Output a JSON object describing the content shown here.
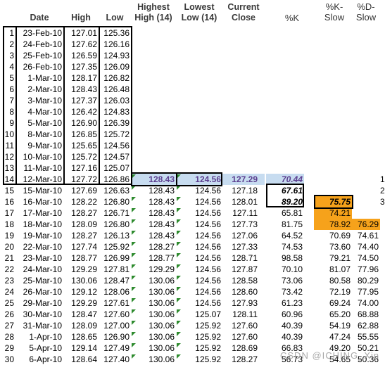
{
  "headers": {
    "date": "Date",
    "high": "High",
    "low": "Low",
    "highest_high": [
      "Highest",
      "High (14)"
    ],
    "lowest_low": [
      "Lowest",
      "Low (14)"
    ],
    "current_close": [
      "Current",
      "Close"
    ],
    "pct_k": "%K",
    "pct_k_slow": [
      "%K-",
      "Slow"
    ],
    "pct_d_slow": [
      "%D-",
      "Slow"
    ]
  },
  "rows": [
    {
      "n": "1",
      "date": "23-Feb-10",
      "high": "127.01",
      "low": "125.36",
      "hh": "",
      "ll": "",
      "cc": "",
      "k": "",
      "ks": "",
      "ds": "",
      "ex": ""
    },
    {
      "n": "2",
      "date": "24-Feb-10",
      "high": "127.62",
      "low": "126.16",
      "hh": "",
      "ll": "",
      "cc": "",
      "k": "",
      "ks": "",
      "ds": "",
      "ex": ""
    },
    {
      "n": "3",
      "date": "25-Feb-10",
      "high": "126.59",
      "low": "124.93",
      "hh": "",
      "ll": "",
      "cc": "",
      "k": "",
      "ks": "",
      "ds": "",
      "ex": ""
    },
    {
      "n": "4",
      "date": "26-Feb-10",
      "high": "127.35",
      "low": "126.09",
      "hh": "",
      "ll": "",
      "cc": "",
      "k": "",
      "ks": "",
      "ds": "",
      "ex": ""
    },
    {
      "n": "5",
      "date": "1-Mar-10",
      "high": "128.17",
      "low": "126.82",
      "hh": "",
      "ll": "",
      "cc": "",
      "k": "",
      "ks": "",
      "ds": "",
      "ex": ""
    },
    {
      "n": "6",
      "date": "2-Mar-10",
      "high": "128.43",
      "low": "126.48",
      "hh": "",
      "ll": "",
      "cc": "",
      "k": "",
      "ks": "",
      "ds": "",
      "ex": ""
    },
    {
      "n": "7",
      "date": "3-Mar-10",
      "high": "127.37",
      "low": "126.03",
      "hh": "",
      "ll": "",
      "cc": "",
      "k": "",
      "ks": "",
      "ds": "",
      "ex": ""
    },
    {
      "n": "8",
      "date": "4-Mar-10",
      "high": "126.42",
      "low": "124.83",
      "hh": "",
      "ll": "",
      "cc": "",
      "k": "",
      "ks": "",
      "ds": "",
      "ex": ""
    },
    {
      "n": "9",
      "date": "5-Mar-10",
      "high": "126.90",
      "low": "126.39",
      "hh": "",
      "ll": "",
      "cc": "",
      "k": "",
      "ks": "",
      "ds": "",
      "ex": ""
    },
    {
      "n": "10",
      "date": "8-Mar-10",
      "high": "126.85",
      "low": "125.72",
      "hh": "",
      "ll": "",
      "cc": "",
      "k": "",
      "ks": "",
      "ds": "",
      "ex": ""
    },
    {
      "n": "11",
      "date": "9-Mar-10",
      "high": "125.65",
      "low": "124.56",
      "hh": "",
      "ll": "",
      "cc": "",
      "k": "",
      "ks": "",
      "ds": "",
      "ex": ""
    },
    {
      "n": "12",
      "date": "10-Mar-10",
      "high": "125.72",
      "low": "124.57",
      "hh": "",
      "ll": "",
      "cc": "",
      "k": "",
      "ks": "",
      "ds": "",
      "ex": ""
    },
    {
      "n": "13",
      "date": "11-Mar-10",
      "high": "127.16",
      "low": "125.07",
      "hh": "",
      "ll": "",
      "cc": "",
      "k": "",
      "ks": "",
      "ds": "",
      "ex": ""
    },
    {
      "n": "14",
      "date": "12-Mar-10",
      "high": "127.72",
      "low": "126.86",
      "hh": "128.43",
      "ll": "124.56",
      "cc": "127.29",
      "k": "70.44",
      "ks": "",
      "ds": "",
      "ex": "1"
    },
    {
      "n": "15",
      "date": "15-Mar-10",
      "high": "127.69",
      "low": "126.63",
      "hh": "128.43",
      "ll": "124.56",
      "cc": "127.18",
      "k": "67.61",
      "ks": "",
      "ds": "",
      "ex": "2"
    },
    {
      "n": "16",
      "date": "16-Mar-10",
      "high": "128.22",
      "low": "126.80",
      "hh": "128.43",
      "ll": "124.56",
      "cc": "128.01",
      "k": "89.20",
      "ks": "75.75",
      "ds": "",
      "ex": "3"
    },
    {
      "n": "17",
      "date": "17-Mar-10",
      "high": "128.27",
      "low": "126.71",
      "hh": "128.43",
      "ll": "124.56",
      "cc": "127.11",
      "k": "65.81",
      "ks": "74.21",
      "ds": "",
      "ex": ""
    },
    {
      "n": "18",
      "date": "18-Mar-10",
      "high": "128.09",
      "low": "126.80",
      "hh": "128.43",
      "ll": "124.56",
      "cc": "127.73",
      "k": "81.75",
      "ks": "78.92",
      "ds": "76.29",
      "ex": ""
    },
    {
      "n": "19",
      "date": "19-Mar-10",
      "high": "128.27",
      "low": "126.13",
      "hh": "128.43",
      "ll": "124.56",
      "cc": "127.06",
      "k": "64.52",
      "ks": "70.69",
      "ds": "74.61",
      "ex": ""
    },
    {
      "n": "20",
      "date": "22-Mar-10",
      "high": "127.74",
      "low": "125.92",
      "hh": "128.27",
      "ll": "124.56",
      "cc": "127.33",
      "k": "74.53",
      "ks": "73.60",
      "ds": "74.40",
      "ex": ""
    },
    {
      "n": "21",
      "date": "23-Mar-10",
      "high": "128.77",
      "low": "126.99",
      "hh": "128.77",
      "ll": "124.56",
      "cc": "128.71",
      "k": "98.58",
      "ks": "79.21",
      "ds": "74.50",
      "ex": ""
    },
    {
      "n": "22",
      "date": "24-Mar-10",
      "high": "129.29",
      "low": "127.81",
      "hh": "129.29",
      "ll": "124.56",
      "cc": "127.87",
      "k": "70.10",
      "ks": "81.07",
      "ds": "77.96",
      "ex": ""
    },
    {
      "n": "23",
      "date": "25-Mar-10",
      "high": "130.06",
      "low": "128.47",
      "hh": "130.06",
      "ll": "124.56",
      "cc": "128.58",
      "k": "73.06",
      "ks": "80.58",
      "ds": "80.29",
      "ex": ""
    },
    {
      "n": "24",
      "date": "26-Mar-10",
      "high": "129.12",
      "low": "128.06",
      "hh": "130.06",
      "ll": "124.56",
      "cc": "128.60",
      "k": "73.42",
      "ks": "72.19",
      "ds": "77.95",
      "ex": ""
    },
    {
      "n": "25",
      "date": "29-Mar-10",
      "high": "129.29",
      "low": "127.61",
      "hh": "130.06",
      "ll": "124.56",
      "cc": "127.93",
      "k": "61.23",
      "ks": "69.24",
      "ds": "74.00",
      "ex": ""
    },
    {
      "n": "26",
      "date": "30-Mar-10",
      "high": "128.47",
      "low": "127.60",
      "hh": "130.06",
      "ll": "125.07",
      "cc": "128.11",
      "k": "60.96",
      "ks": "65.20",
      "ds": "68.88",
      "ex": ""
    },
    {
      "n": "27",
      "date": "31-Mar-10",
      "high": "128.09",
      "low": "127.00",
      "hh": "130.06",
      "ll": "125.92",
      "cc": "127.60",
      "k": "40.39",
      "ks": "54.19",
      "ds": "62.88",
      "ex": ""
    },
    {
      "n": "28",
      "date": "1-Apr-10",
      "high": "128.65",
      "low": "126.90",
      "hh": "130.06",
      "ll": "125.92",
      "cc": "127.60",
      "k": "40.39",
      "ks": "47.24",
      "ds": "55.55",
      "ex": ""
    },
    {
      "n": "29",
      "date": "5-Apr-10",
      "high": "129.14",
      "low": "127.49",
      "hh": "130.06",
      "ll": "125.92",
      "cc": "128.69",
      "k": "66.83",
      "ks": "49.20",
      "ds": "50.21",
      "ex": ""
    },
    {
      "n": "30",
      "date": "6-Apr-10",
      "high": "128.64",
      "low": "127.40",
      "hh": "130.06",
      "ll": "125.92",
      "cc": "128.27",
      "k": "56.73",
      "ks": "54.65",
      "ds": "50.36",
      "ex": ""
    }
  ],
  "watermark": "CSDN @ICHING_Xin",
  "colors": {
    "highlight_blue": "#c7dcf0",
    "highlight_orange": "#f6a21b",
    "purple_text": "#5b3e8f",
    "triangle_green": "#2e8b2e"
  }
}
